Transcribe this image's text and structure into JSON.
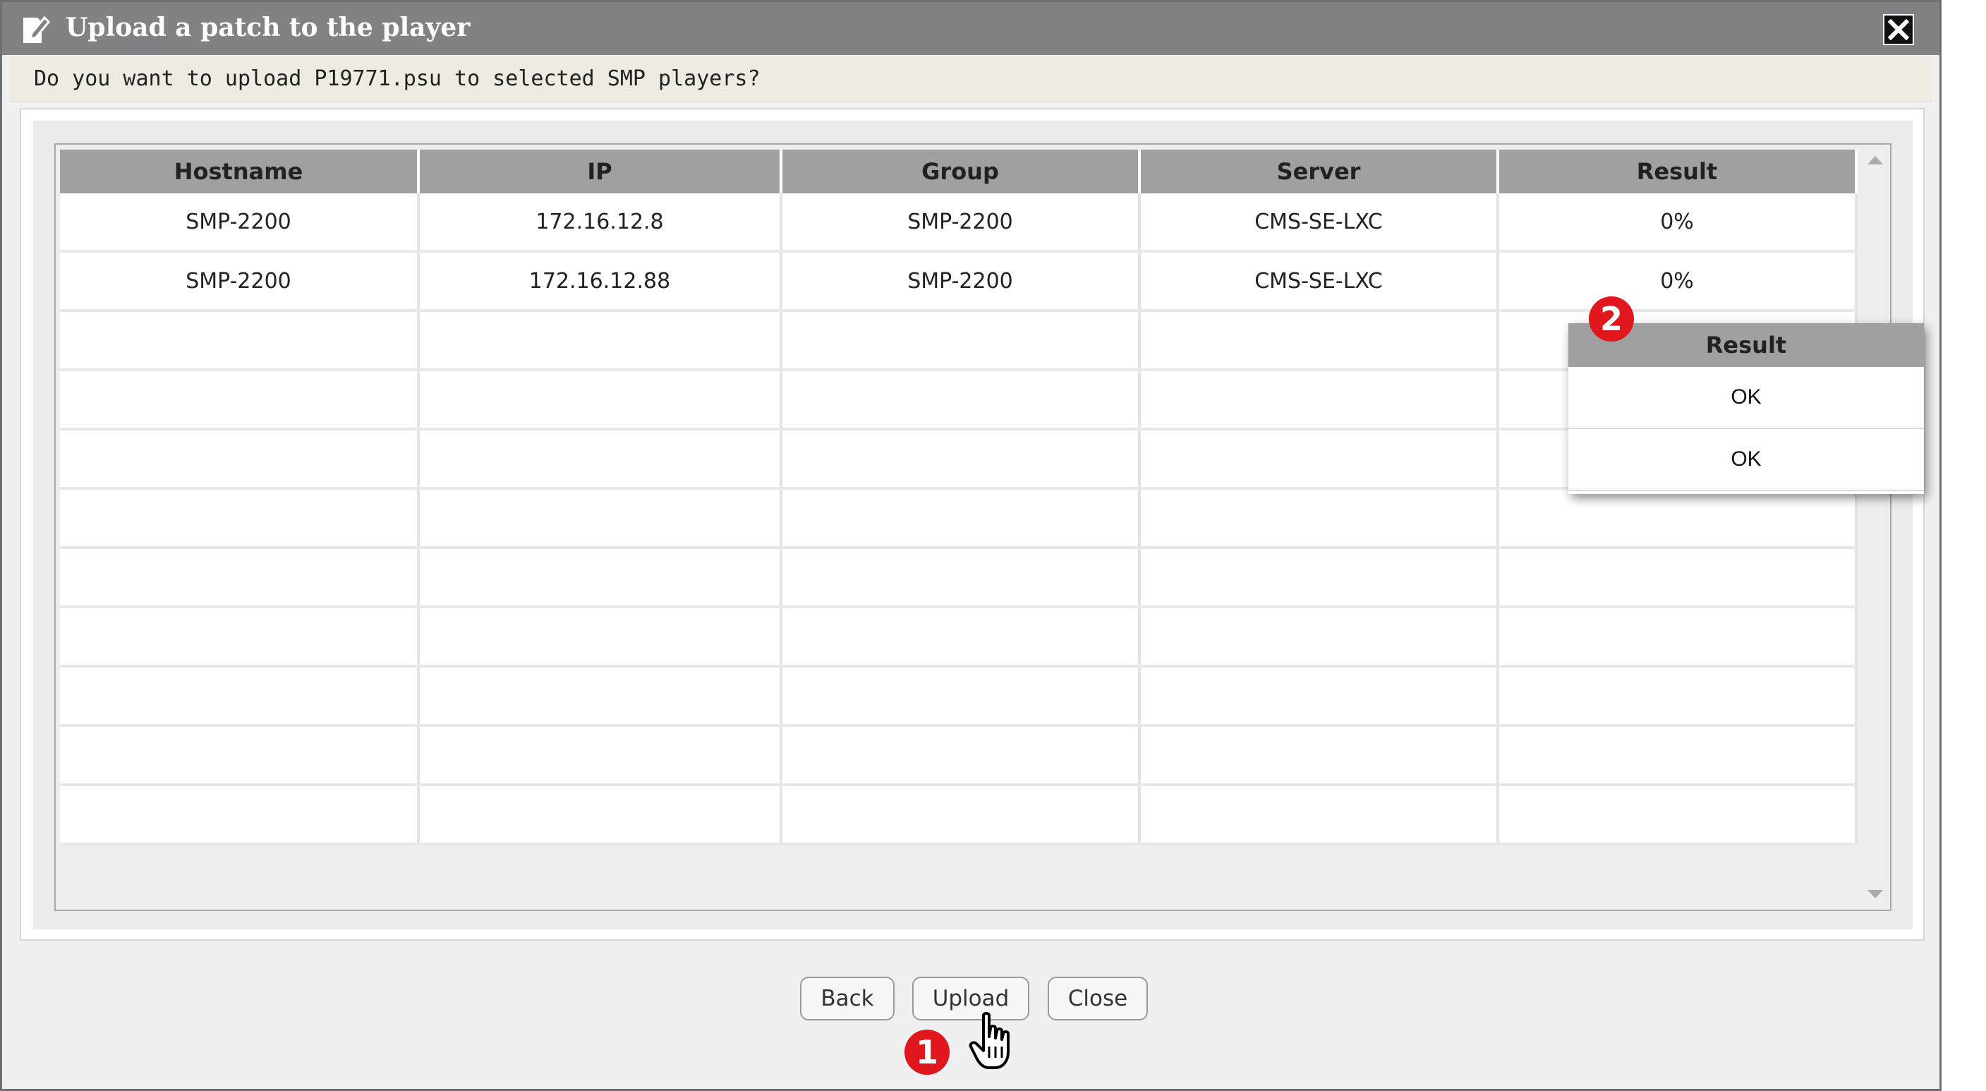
{
  "dialog": {
    "title": "Upload a patch to the player",
    "prompt": "Do you want to upload P19771.psu to selected SMP players?"
  },
  "table": {
    "columns": [
      "Hostname",
      "IP",
      "Group",
      "Server",
      "Result"
    ],
    "rows": [
      [
        "SMP-2200",
        "172.16.12.8",
        "SMP-2200",
        "CMS-SE-LXC",
        "0%"
      ],
      [
        "SMP-2200",
        "172.16.12.88",
        "SMP-2200",
        "CMS-SE-LXC",
        "0%"
      ],
      [
        "",
        "",
        "",
        "",
        ""
      ],
      [
        "",
        "",
        "",
        "",
        ""
      ],
      [
        "",
        "",
        "",
        "",
        ""
      ],
      [
        "",
        "",
        "",
        "",
        ""
      ],
      [
        "",
        "",
        "",
        "",
        ""
      ],
      [
        "",
        "",
        "",
        "",
        ""
      ],
      [
        "",
        "",
        "",
        "",
        ""
      ],
      [
        "",
        "",
        "",
        "",
        ""
      ],
      [
        "",
        "",
        "",
        "",
        ""
      ]
    ]
  },
  "result_popup": {
    "header": "Result",
    "rows": [
      "OK",
      "OK"
    ]
  },
  "buttons": {
    "back": "Back",
    "upload": "Upload",
    "close": "Close"
  },
  "markers": {
    "step1": "1",
    "step2": "2"
  },
  "colors": {
    "titlebar": "#808285",
    "header": "#a0a0a0",
    "marker": "#e0181e",
    "prompt_bg": "#efebe2"
  },
  "icons": {
    "title": "edit-document-icon",
    "close": "close-icon",
    "cursor": "hand-pointer-icon"
  }
}
